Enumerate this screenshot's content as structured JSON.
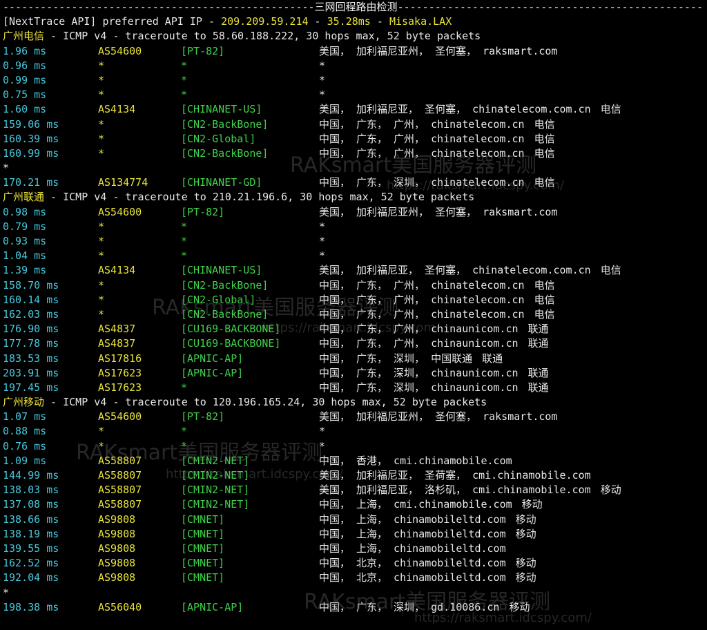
{
  "header": {
    "separator_left": "--------------------------------------------------",
    "title": "三网回程路由检测",
    "separator_right": "-------------------------------------------------",
    "api_prefix": "[NextTrace API]",
    "api_mid": " preferred API IP - ",
    "api_ip": "209.209.59.214",
    "api_dash": " - ",
    "api_latency": "35.28ms",
    "api_dash2": " - ",
    "api_node": "Misaka.LAX"
  },
  "watermark": {
    "text": "RAKsmart美国服务器评测",
    "url": "https://raksmart.idcspy.com/"
  },
  "traces": [
    {
      "name": "广州电信",
      "info": " - ICMP v4 - traceroute to 58.60.188.222, 30 hops max, 52 byte packets",
      "hops": [
        {
          "lat": "1.96 ms",
          "as": "AS54600",
          "net": "[PT-82]",
          "geo": "美国， 加利福尼亚州， 圣何塞， raksmart.com",
          "isp": ""
        },
        {
          "lat": "0.96 ms",
          "as": "*",
          "net": "*",
          "geo": "*",
          "isp": ""
        },
        {
          "lat": "0.99 ms",
          "as": "*",
          "net": "*",
          "geo": "*",
          "isp": ""
        },
        {
          "lat": "0.75 ms",
          "as": "*",
          "net": "*",
          "geo": "*",
          "isp": ""
        },
        {
          "lat": "1.60 ms",
          "as": "AS4134",
          "net": "[CHINANET-US]",
          "geo": "美国， 加利福尼亚， 圣何塞， chinatelecom.com.cn",
          "isp": "电信"
        },
        {
          "lat": "159.06 ms",
          "as": "*",
          "net": "[CN2-BackBone]",
          "geo": "中国， 广东， 广州， chinatelecom.cn",
          "isp": "电信"
        },
        {
          "lat": "160.39 ms",
          "as": "*",
          "net": "[CN2-Global]",
          "geo": "中国， 广东， 广州， chinatelecom.cn",
          "isp": "电信"
        },
        {
          "lat": "160.99 ms",
          "as": "*",
          "net": "[CN2-BackBone]",
          "geo": "中国， 广东， 广州， chinatelecom.cn",
          "isp": "电信"
        },
        {
          "star": "*"
        },
        {
          "lat": "170.21 ms",
          "as": "AS134774",
          "net": "[CHINANET-GD]",
          "geo": "中国， 广东， 深圳， chinatelecom.cn",
          "isp": "电信"
        }
      ]
    },
    {
      "name": "广州联通",
      "info": " - ICMP v4 - traceroute to 210.21.196.6, 30 hops max, 52 byte packets",
      "hops": [
        {
          "lat": "0.98 ms",
          "as": "AS54600",
          "net": "[PT-82]",
          "geo": "美国， 加利福尼亚州， 圣何塞， raksmart.com",
          "isp": ""
        },
        {
          "lat": "0.79 ms",
          "as": "*",
          "net": "*",
          "geo": "*",
          "isp": ""
        },
        {
          "lat": "0.93 ms",
          "as": "*",
          "net": "*",
          "geo": "*",
          "isp": ""
        },
        {
          "lat": "1.04 ms",
          "as": "*",
          "net": "*",
          "geo": "*",
          "isp": ""
        },
        {
          "lat": "1.39 ms",
          "as": "AS4134",
          "net": "[CHINANET-US]",
          "geo": "美国， 加利福尼亚， 圣何塞， chinatelecom.com.cn",
          "isp": "电信"
        },
        {
          "lat": "158.70 ms",
          "as": "*",
          "net": "[CN2-BackBone]",
          "geo": "中国， 广东， 广州， chinatelecom.cn",
          "isp": "电信"
        },
        {
          "lat": "160.14 ms",
          "as": "*",
          "net": "[CN2-Global]",
          "geo": "中国， 广东， 广州， chinatelecom.cn",
          "isp": "电信"
        },
        {
          "lat": "162.03 ms",
          "as": "*",
          "net": "[CN2-BackBone]",
          "geo": "中国， 广东， 广州， chinatelecom.cn",
          "isp": "电信"
        },
        {
          "lat": "176.90 ms",
          "as": "AS4837",
          "net": "[CU169-BACKBONE]",
          "geo": "中国， 广东， 广州， chinaunicom.cn",
          "isp": "联通"
        },
        {
          "lat": "177.78 ms",
          "as": "AS4837",
          "net": "[CU169-BACKBONE]",
          "geo": "中国， 广东， 广州， chinaunicom.cn",
          "isp": "联通"
        },
        {
          "lat": "183.53 ms",
          "as": "AS17816",
          "net": "[APNIC-AP]",
          "geo": "中国， 广东， 深圳， 中国联通",
          "isp": "联通"
        },
        {
          "lat": "203.91 ms",
          "as": "AS17623",
          "net": "[APNIC-AP]",
          "geo": "中国， 广东， 深圳， chinaunicom.cn",
          "isp": "联通"
        },
        {
          "lat": "197.45 ms",
          "as": "AS17623",
          "net": "*",
          "geo": "中国， 广东， 深圳， chinaunicom.cn",
          "isp": "联通"
        }
      ]
    },
    {
      "name": "广州移动",
      "info": " - ICMP v4 - traceroute to 120.196.165.24, 30 hops max, 52 byte packets",
      "hops": [
        {
          "lat": "1.07 ms",
          "as": "AS54600",
          "net": "[PT-82]",
          "geo": "美国， 加利福尼亚州， 圣何塞， raksmart.com",
          "isp": ""
        },
        {
          "lat": "0.88 ms",
          "as": "*",
          "net": "*",
          "geo": "*",
          "isp": ""
        },
        {
          "lat": "0.76 ms",
          "as": "*",
          "net": "*",
          "geo": "*",
          "isp": ""
        },
        {
          "lat": "1.09 ms",
          "as": "AS58807",
          "net": "[CMIN2-NET]",
          "geo": "中国， 香港， cmi.chinamobile.com",
          "isp": ""
        },
        {
          "lat": "144.99 ms",
          "as": "AS58807",
          "net": "[CMIN2-NET]",
          "geo": "美国， 加利福尼亚， 圣荷塞， cmi.chinamobile.com",
          "isp": ""
        },
        {
          "lat": "138.03 ms",
          "as": "AS58807",
          "net": "[CMIN2-NET]",
          "geo": "美国， 加利福尼亚， 洛杉矶， cmi.chinamobile.com",
          "isp": "移动"
        },
        {
          "lat": "137.08 ms",
          "as": "AS58807",
          "net": "[CMIN2-NET]",
          "geo": "中国， 上海， cmi.chinamobile.com",
          "isp": "移动"
        },
        {
          "lat": "138.66 ms",
          "as": "AS9808",
          "net": "[CMNET]",
          "geo": "中国， 上海， chinamobileltd.com",
          "isp": "移动"
        },
        {
          "lat": "138.19 ms",
          "as": "AS9808",
          "net": "[CMNET]",
          "geo": "中国， 上海， chinamobileltd.com",
          "isp": "移动"
        },
        {
          "lat": "139.55 ms",
          "as": "AS9808",
          "net": "[CMNET]",
          "geo": "中国， 上海， chinamobileltd.com",
          "isp": ""
        },
        {
          "lat": "162.52 ms",
          "as": "AS9808",
          "net": "[CMNET]",
          "geo": "中国， 北京， chinamobileltd.com",
          "isp": "移动"
        },
        {
          "lat": "192.04 ms",
          "as": "AS9808",
          "net": "[CMNET]",
          "geo": "中国， 北京， chinamobileltd.com",
          "isp": "移动"
        },
        {
          "star": "*"
        },
        {
          "lat": "198.38 ms",
          "as": "AS56040",
          "net": "[APNIC-AP]",
          "geo": "中国， 广东， 深圳， gd.10086.cn",
          "isp": "移动"
        }
      ]
    }
  ]
}
